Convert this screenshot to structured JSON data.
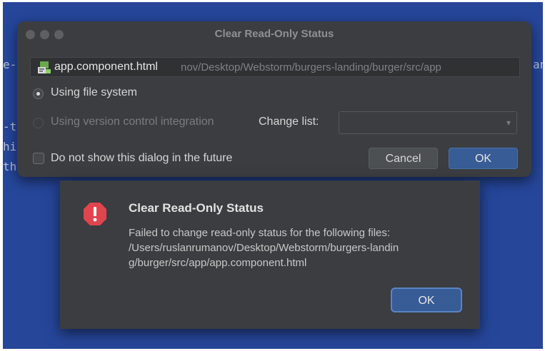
{
  "background_code": {
    "lines": [
      "e-",
      "-t",
      "hi",
      "th"
    ],
    "right_fragment": "an"
  },
  "main_dialog": {
    "title": "Clear Read-Only Status",
    "file_name": "app.component.html",
    "file_path": "nov/Desktop/Webstorm/burgers-landing/burger/src/app",
    "option_file_system": "Using file system",
    "option_vcs": "Using version control integration",
    "change_list_label": "Change list:",
    "change_list_value": "",
    "checkbox_label": "Do not show this dialog in the future",
    "cancel_label": "Cancel",
    "ok_label": "OK"
  },
  "error_dialog": {
    "title": "Clear Read-Only Status",
    "message_lines": [
      "Failed to change read-only status for the following files:",
      "/Users/ruslanrumanov/Desktop/Webstorm/burgers-landin",
      "g/burger/src/app/app.component.html"
    ],
    "ok_label": "OK"
  },
  "colors": {
    "background": "#26469a",
    "dialog": "#3b3d40",
    "primary_button": "#375c96",
    "error_icon": "#e0454f"
  },
  "icons": {
    "file": "html-file-icon",
    "error": "error-icon"
  }
}
